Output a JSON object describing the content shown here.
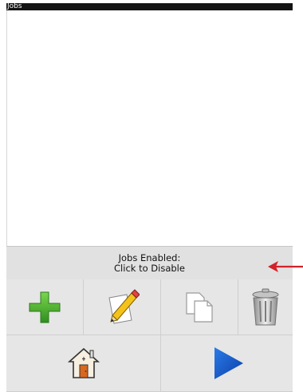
{
  "window": {
    "title": "Jobs"
  },
  "status": {
    "line1": "Jobs Enabled:",
    "line2": "Click to Disable"
  },
  "toolbar": {
    "buttons": [
      {
        "icon": "add-icon",
        "color": "#3fae2a"
      },
      {
        "icon": "edit-pencil-icon",
        "color": "#f0c020"
      },
      {
        "icon": "copy-icon",
        "color": "#ffffff"
      },
      {
        "icon": "trash-icon",
        "color": "#9a9a9a"
      }
    ]
  },
  "bottom": {
    "buttons": [
      {
        "icon": "home-icon"
      },
      {
        "icon": "play-icon",
        "color": "#1a5fd0"
      }
    ]
  },
  "annotation": {
    "arrow_color": "#d0232a"
  }
}
